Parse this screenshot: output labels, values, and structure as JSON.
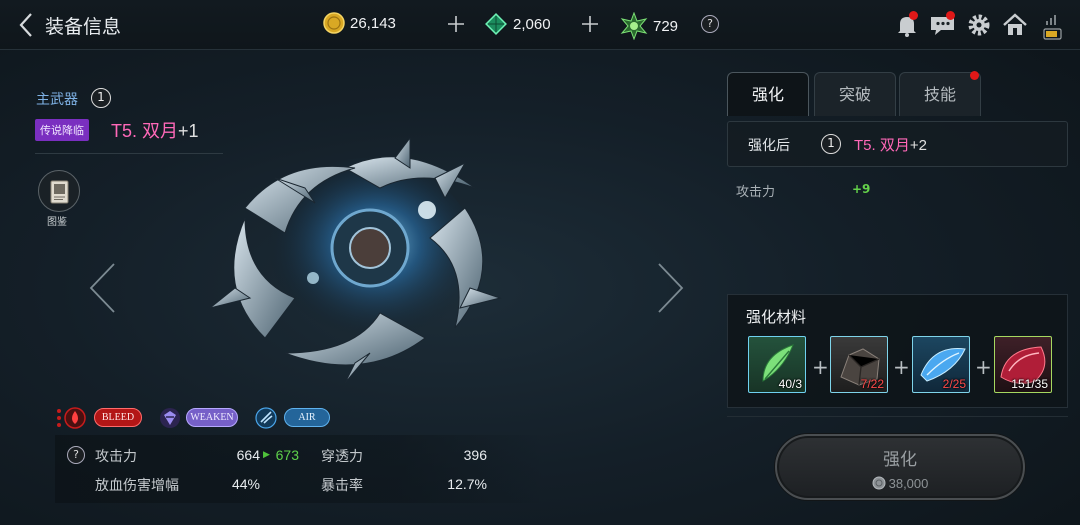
{
  "header": {
    "title": "装备信息",
    "gold": "26,143",
    "gems": "2,060",
    "tokens": "729",
    "help": "?"
  },
  "item": {
    "slot": "主武器",
    "slot_count": "1",
    "tag": "传说降临",
    "name": "T5. 双月",
    "plus": "+1",
    "codex": "图鉴"
  },
  "effects": [
    "BLEED",
    "WEAKEN",
    "AIR"
  ],
  "stats": {
    "help": "?",
    "rows": [
      {
        "l1": "攻击力",
        "v1": "664",
        "v1_next": "673",
        "l2": "穿透力",
        "v2": "396"
      },
      {
        "l1": "放血伤害增幅",
        "v1": "44%",
        "l2": "暴击率",
        "v2": "12.7%"
      }
    ]
  },
  "tabs": [
    {
      "label": "强化",
      "active": true
    },
    {
      "label": "突破",
      "active": false
    },
    {
      "label": "技能",
      "active": false,
      "dot": true
    }
  ],
  "enhance": {
    "after_label": "强化后",
    "after_count": "1",
    "after_name": "T5. 双月",
    "after_plus": "+2",
    "attr_label": "攻击力",
    "attr_delta": "+9",
    "materials_title": "强化材料",
    "materials": [
      {
        "count": "40/3",
        "enough": true,
        "icon": "green-feather"
      },
      {
        "count": "7/22",
        "enough": false,
        "icon": "dark-ore"
      },
      {
        "count": "2/25",
        "enough": false,
        "icon": "blue-crystal"
      },
      {
        "count": "151/35",
        "enough": true,
        "icon": "red-stone"
      }
    ],
    "button_label": "强化",
    "cost": "38,000"
  }
}
